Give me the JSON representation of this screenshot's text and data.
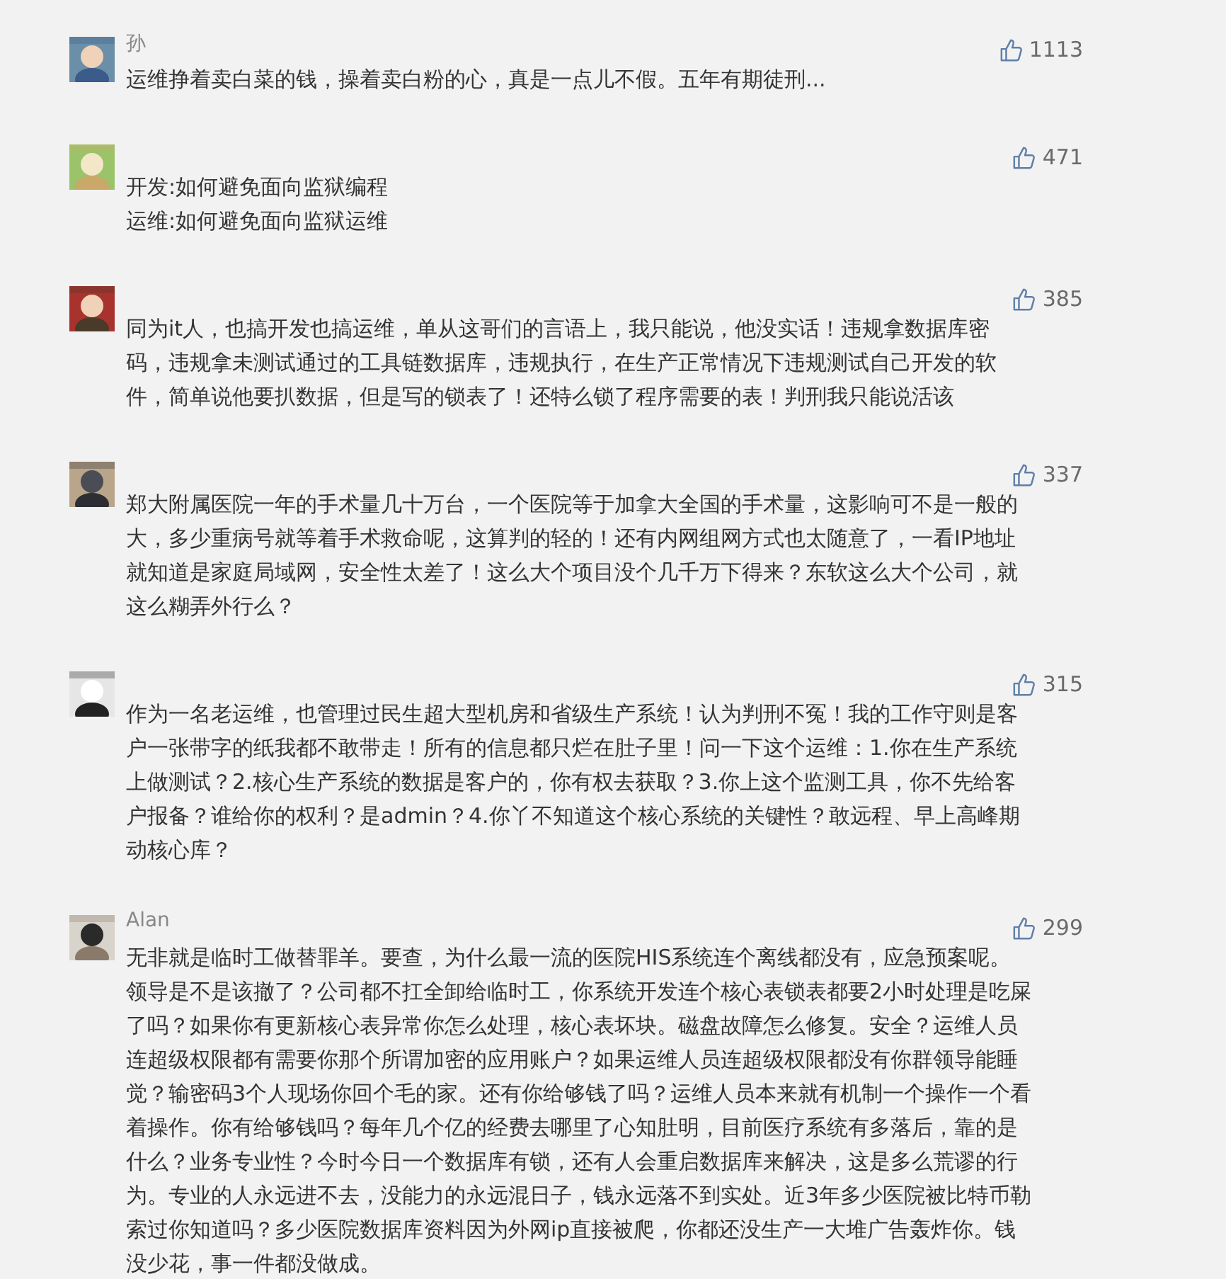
{
  "comments": [
    {
      "name": "孙",
      "likes": "1113",
      "text": "运维挣着卖白菜的钱，操着卖白粉的心，真是一点儿不假。五年有期徒刑..."
    },
    {
      "likes": "471",
      "lines": [
        "开发:如何避免面向监狱编程",
        "运维:如何避免面向监狱运维"
      ]
    },
    {
      "likes": "385",
      "text": "同为it人，也搞开发也搞运维，单从这哥们的言语上，我只能说，他没实话！违规拿数据库密码，违规拿未测试通过的工具链数据库，违规执行，在生产正常情况下违规测试自己开发的软件，简单说他要扒数据，但是写的锁表了！还特么锁了程序需要的表！判刑我只能说活该"
    },
    {
      "likes": "337",
      "text": "郑大附属医院一年的手术量几十万台，一个医院等于加拿大全国的手术量，这影响可不是一般的大，多少重病号就等着手术救命呢，这算判的轻的！还有内网组网方式也太随意了，一看IP地址就知道是家庭局域网，安全性太差了！这么大个项目没个几千万下得来？东软这么大个公司，就这么糊弄外行么？"
    },
    {
      "likes": "315",
      "text": "作为一名老运维，也管理过民生超大型机房和省级生产系统！认为判刑不冤！我的工作守则是客户一张带字的纸我都不敢带走！所有的信息都只烂在肚子里！问一下这个运维：1.你在生产系统上做测试？2.核心生产系统的数据是客户的，你有权去获取？3.你上这个监测工具，你不先给客户报备？谁给你的权利？是admin？4.你丫不知道这个核心系统的关键性？敢远程、早上高峰期动核心库？"
    },
    {
      "name": "Alan",
      "likes": "299",
      "text": "无非就是临时工做替罪羊。要查，为什么最一流的医院HIS系统连个离线都没有，应急预案呢。领导是不是该撤了？公司都不扛全卸给临时工，你系统开发连个核心表锁表都要2小时处理是吃屎了吗？如果你有更新核心表异常你怎么处理，核心表坏块。磁盘故障怎么修复。安全？运维人员连超级权限都有需要你那个所谓加密的应用账户？如果运维人员连超级权限都没有你群领导能睡觉？输密码3个人现场你回个毛的家。还有你给够钱了吗？运维人员本来就有机制一个操作一个看着操作。你有给够钱吗？每年几个亿的经费去哪里了心知肚明，目前医疗系统有多落后，靠的是什么？业务专业性？今时今日一个数据库有锁，还有人会重启数据库来解决，这是多么荒谬的行为。专业的人永远进不去，没能力的永远混日子，钱永远落不到实处。近3年多少医院被比特币勒索过你知道吗？多少医院数据库资料因为外网ip直接被爬，你都还没生产一大堆广告轰炸你。钱没少花，事一件都没做成。"
    }
  ]
}
